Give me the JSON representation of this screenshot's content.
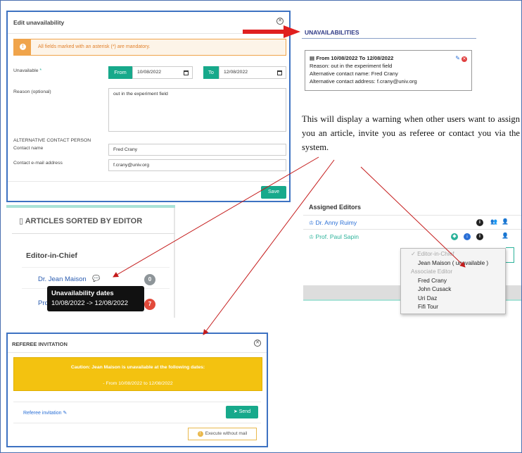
{
  "edit_modal": {
    "title": "Edit unavailability",
    "alert": "All fields marked with an asterisk (*) are mandatory.",
    "unavailable_label": "Unavailable",
    "required_mark": "*",
    "from_label": "From",
    "from_value": "10/08/2022",
    "to_label": "To",
    "to_value": "12/08/2022",
    "reason_label": "Reason (optional)",
    "reason_value": "out in the experiment field",
    "alt_contact_heading": "ALTERNATIVE CONTACT PERSON",
    "contact_name_label": "Contact name",
    "contact_name_value": "Fred Crany",
    "contact_email_label": "Contact e-mail address",
    "contact_email_value": "f.crany@univ.org",
    "save_label": "Save"
  },
  "unavailabilities": {
    "title": "UNAVAILABILITIES",
    "card": {
      "header": "From 10/08/2022 To 12/08/2022",
      "reason": "Reason: out in the experiment field",
      "alt_name": "Alternative contact name: Fred Crany",
      "alt_address": "Alternative contact address: f.crany@univ.org"
    }
  },
  "explanation": "This will display a warning when other users want to assign you an article, invite you as referee or contact you via the system.",
  "articles_panel": {
    "title": "ARTICLES SORTED BY EDITOR",
    "group": "Editor-in-Chief",
    "editors": [
      {
        "name": "Dr. Jean Maison",
        "count": "0",
        "badge_color": "#8e9599"
      },
      {
        "name": "Pro",
        "count": "7",
        "badge_color": "#e24a3b"
      }
    ],
    "tooltip_title": "Unavailability dates",
    "tooltip_dates": "10/08/2022 -> 12/08/2022"
  },
  "assigned_editors": {
    "title": "Assigned Editors",
    "editors": [
      "Dr. Anny Ruimy",
      "Prof. Paul Sapin"
    ]
  },
  "dropdown": {
    "group1": "Editor-in-Chief",
    "selected": "Jean Maison ( unavailable )",
    "group2": "Associate Editor",
    "options": [
      "Fred Crany",
      "John Cusack",
      "Uri Daz",
      "Fifi Tour"
    ]
  },
  "referee_modal": {
    "title": "REFEREE INVITATION",
    "caution_line1": "Caution: Jean Maison is unavailable at the following dates:",
    "caution_line2": "- From 10/08/2022 to 12/08/2022",
    "link": "Referee invitation",
    "send_label": "Send",
    "execute_label": "Execute without mail"
  },
  "colors": {
    "teal": "#17a98b",
    "arrow_red": "#e01f1f",
    "frame_blue": "#3d72c2"
  }
}
